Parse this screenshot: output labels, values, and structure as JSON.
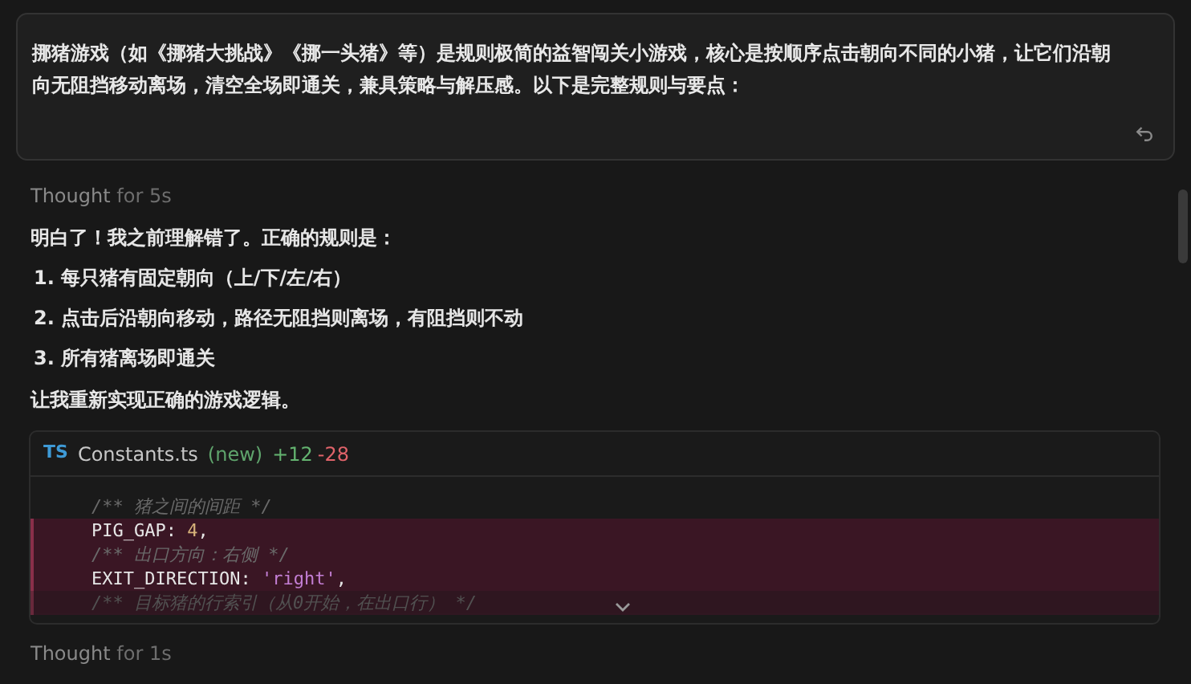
{
  "prompt": {
    "text": "挪猪游戏（如《挪猪大挑战》《挪一头猪》等）是规则极简的益智闯关小游戏，核心是按顺序点击朝向不同的小猪，让它们沿朝向无阻挡移动离场，清空全场即通关，兼具策略与解压感。以下是完整规则与要点："
  },
  "thoughts": [
    {
      "label": "Thought",
      "duration": "for 5s"
    }
  ],
  "reply": {
    "intro": "明白了！我之前理解错了。正确的规则是：",
    "items": [
      {
        "number": "1.",
        "text": "每只猪有固定朝向（上/下/左/右）"
      },
      {
        "number": "2.",
        "text": "点击后沿朝向移动，路径无阻挡则离场，有阻挡则不动"
      },
      {
        "number": "3.",
        "text": "所有猪离场即通关"
      }
    ],
    "outro": "让我重新实现正确的游戏逻辑。"
  },
  "diff": {
    "lang": "TS",
    "file": "Constants.ts",
    "status": "(new)",
    "added": "+12",
    "removed": "-28",
    "collapsed": true,
    "lines": [
      {
        "kind": "context",
        "tokens": [
          {
            "kind": "comment",
            "text": "/** 猪之间的间距 */"
          }
        ]
      },
      {
        "kind": "deleted",
        "tokens": [
          {
            "kind": "key",
            "text": "PIG_GAP: "
          },
          {
            "kind": "number",
            "text": "4"
          },
          {
            "kind": "key",
            "text": ","
          }
        ]
      },
      {
        "kind": "deleted",
        "tokens": [
          {
            "kind": "comment",
            "text": "/** 出口方向：右侧 */"
          }
        ]
      },
      {
        "kind": "deleted",
        "tokens": [
          {
            "kind": "key",
            "text": "EXIT_DIRECTION: "
          },
          {
            "kind": "string",
            "text": "'right'"
          },
          {
            "kind": "key",
            "text": ","
          }
        ]
      },
      {
        "kind": "deleted",
        "tokens": [
          {
            "kind": "comment",
            "text": "/** 目标猪的行索引（从0开始，在出口行） */"
          }
        ]
      }
    ]
  },
  "thought2": {
    "label": "Thought",
    "duration": "for 1s"
  }
}
